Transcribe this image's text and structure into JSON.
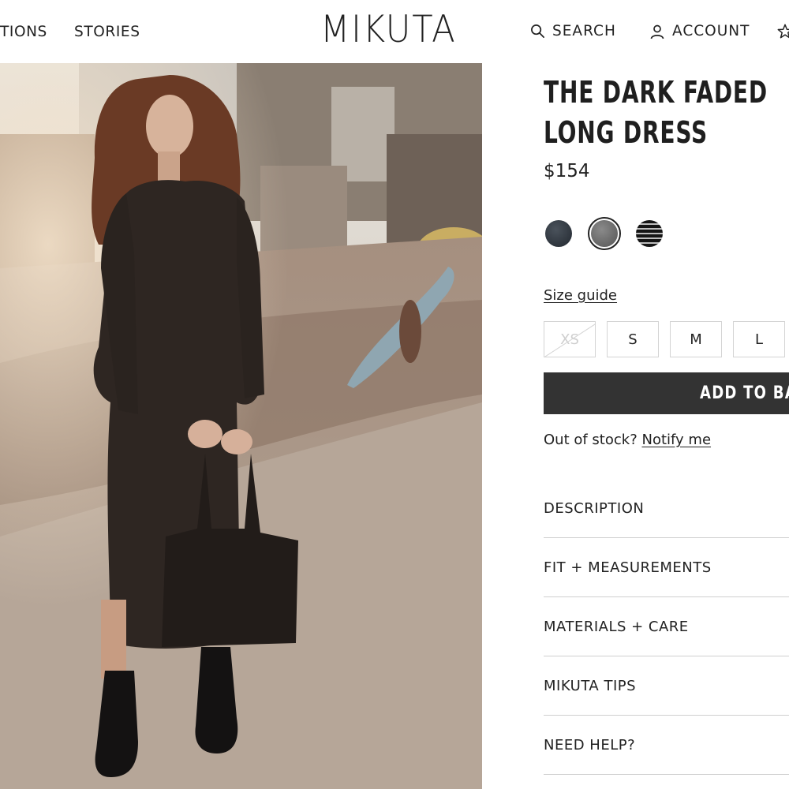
{
  "header": {
    "nav_left": [
      "TIONS",
      "STORIES"
    ],
    "logo": "MIKUTA",
    "search_label": "SEARCH",
    "account_label": "ACCOUNT"
  },
  "product": {
    "title": "THE DARK FADED LONG DRESS",
    "price": "$154",
    "swatches": [
      {
        "name": "dark-navy",
        "color": "#2c333b"
      },
      {
        "name": "faded-grey",
        "color": "#6f6f6f",
        "selected": true
      },
      {
        "name": "striped",
        "color": "#1c1c1c"
      }
    ],
    "size_guide": "Size guide",
    "sizes": [
      {
        "label": "XS",
        "available": false
      },
      {
        "label": "S",
        "available": true
      },
      {
        "label": "M",
        "available": true
      },
      {
        "label": "L",
        "available": true
      }
    ],
    "add_to_bag": "ADD TO BAG",
    "out_of_stock_text": "Out of stock?",
    "notify_link": "Notify me",
    "accordion": [
      "DESCRIPTION",
      "FIT + MEASUREMENTS",
      "MATERIALS + CARE",
      "MIKUTA TIPS",
      "NEED HELP?"
    ]
  },
  "colors": {
    "button_bg": "#333333",
    "text": "#222222",
    "divider": "#cfcfcf"
  }
}
